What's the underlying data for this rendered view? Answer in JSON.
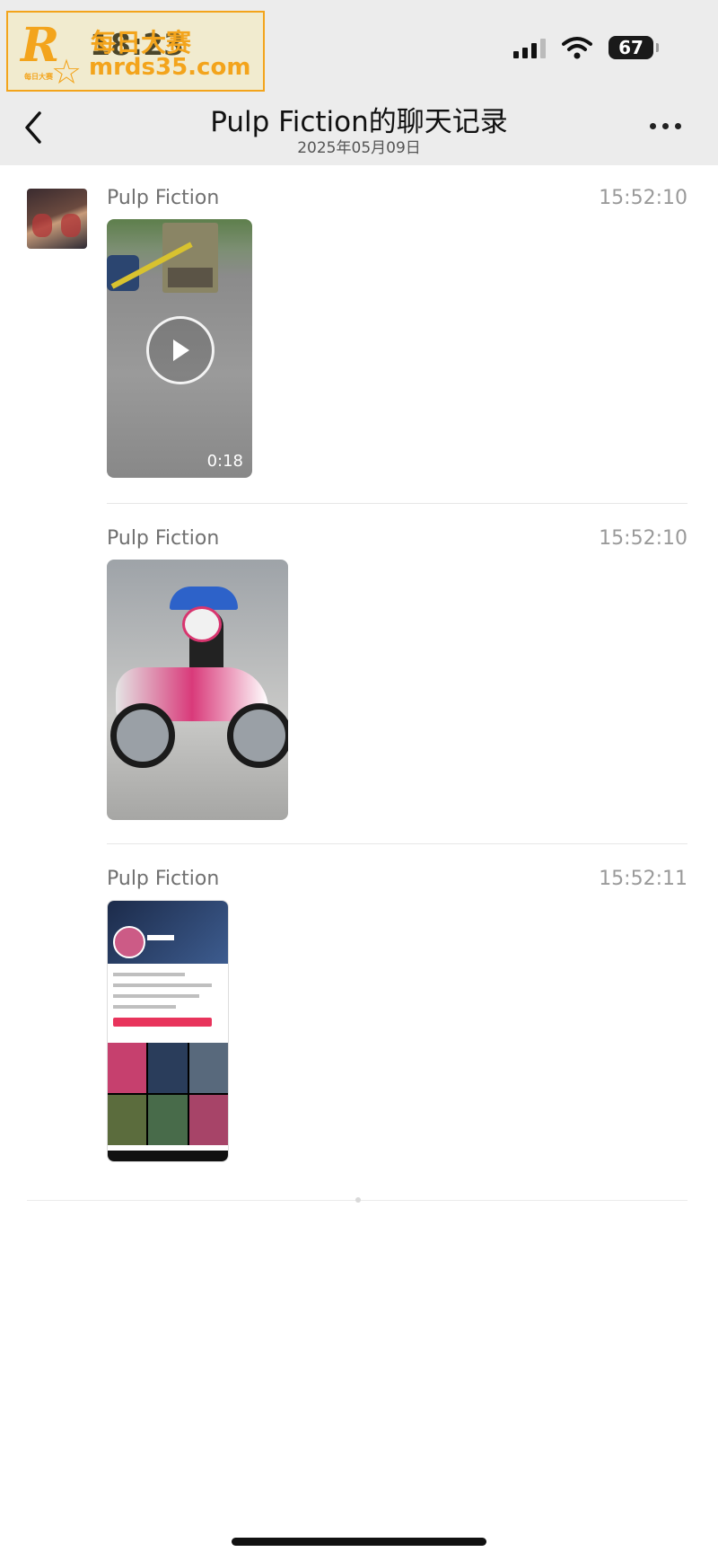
{
  "status_bar": {
    "time": "18:23",
    "battery": "67"
  },
  "watermark": {
    "letter": "R",
    "small_text": "每日大赛",
    "cn": "每日大赛",
    "url": "mrds35.com"
  },
  "header": {
    "title": "Pulp Fiction的聊天记录",
    "date": "2025年05月09日"
  },
  "messages": [
    {
      "sender": "Pulp Fiction",
      "time": "15:52:10",
      "type": "video",
      "duration": "0:18"
    },
    {
      "sender": "Pulp Fiction",
      "time": "15:52:10",
      "type": "image"
    },
    {
      "sender": "Pulp Fiction",
      "time": "15:52:11",
      "type": "image"
    }
  ],
  "icons": [
    "back-arrow-icon",
    "more-icon",
    "play-icon",
    "wifi-icon",
    "signal-icon"
  ]
}
